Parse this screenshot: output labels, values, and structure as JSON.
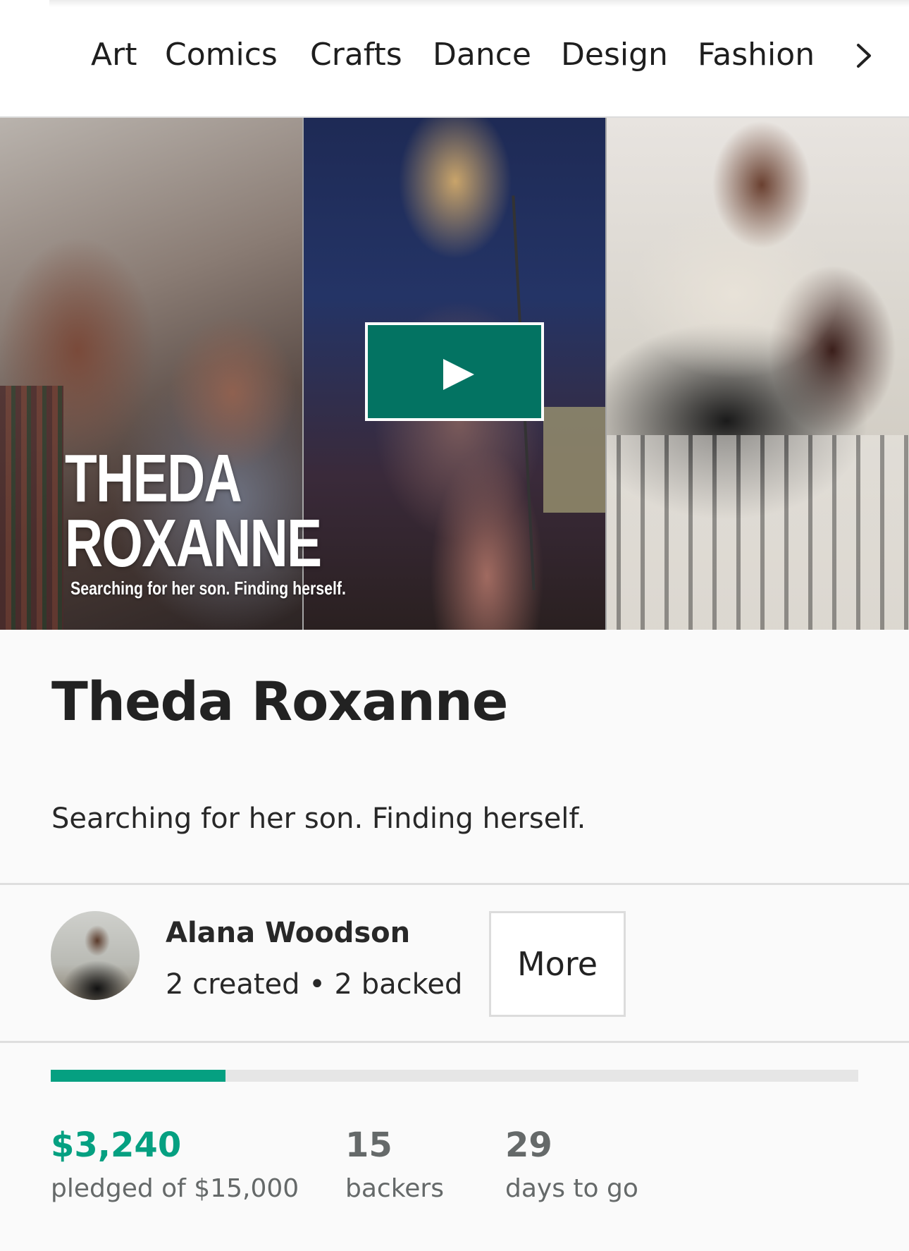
{
  "nav": {
    "categories": [
      "Art",
      "Comics",
      "Crafts",
      "Dance",
      "Design",
      "Fashion"
    ],
    "next_icon": "chevron-right-icon"
  },
  "hero": {
    "title_line1": "THEDA",
    "title_line2": "ROXANNE",
    "subtitle": "Searching for her son. Finding herself.",
    "play_icon": "play-icon",
    "play_color": "#037362"
  },
  "project": {
    "title": "Theda Roxanne",
    "blurb": "Searching for her son. Finding herself."
  },
  "creator": {
    "name": "Alana Woodson",
    "stats": "2 created • 2 backed",
    "more_label": "More"
  },
  "funding": {
    "pledged": "$3,240",
    "pledged_label": "pledged of $15,000",
    "progress_fraction": 0.216,
    "backers": "15",
    "backers_label": "backers",
    "days": "29",
    "days_label": "days to go",
    "accent_color": "#05a081"
  }
}
